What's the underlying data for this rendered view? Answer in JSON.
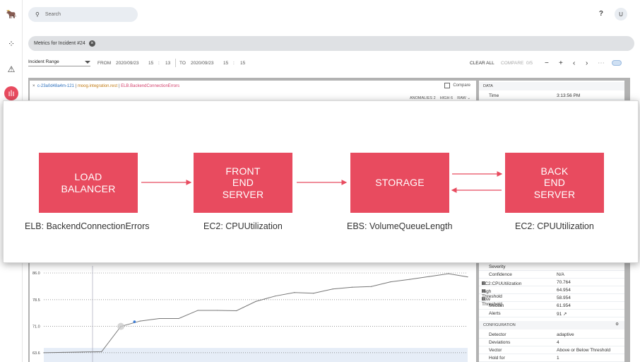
{
  "topbar": {
    "search_placeholder": "Search",
    "help": "?",
    "user_initial": "U"
  },
  "breadcrumb": {
    "label": "Metrics for Incident #24"
  },
  "controls": {
    "range_label": "Incident Range",
    "from_label": "FROM",
    "from_date": "2020/09/23",
    "from_hour": "15",
    "from_min": "13",
    "to_label": "TO",
    "to_date": "2020/09/23",
    "to_hour": "15",
    "to_min": "15",
    "clear_all": "CLEAR ALL",
    "compare": "COMPARE",
    "compare_count": "0/5"
  },
  "metric_card": {
    "close": "×",
    "host": "c-23a0d48a4m-121",
    "source": "moog.integration.rest",
    "metric": "ELB.BackendConnectionErrors",
    "compare_label": "Compare",
    "anomalies_label": "ANOMALIES",
    "anomalies": "2",
    "high_label": "HIGH",
    "high": "6",
    "raw_label": "RAW"
  },
  "data_panel": {
    "section_label": "DATA",
    "time_label": "Time",
    "time_value": "3:13:56 PM",
    "rows": [
      {
        "k": "Severity",
        "v": ""
      },
      {
        "k": "Confidence",
        "v": "N/A"
      },
      {
        "k": "EC2:CPUUtilization",
        "v": "70.764"
      },
      {
        "k": "High Threshold",
        "v": "64.954"
      },
      {
        "k": "Low Threshold",
        "v": "58.954"
      },
      {
        "k": "Median",
        "v": "61.954"
      },
      {
        "k": "Alerts",
        "v": "91 ↗"
      }
    ],
    "config_label": "CONFIGURATION",
    "config_rows": [
      {
        "k": "Detector",
        "v": "adaptive"
      },
      {
        "k": "Deviations",
        "v": "4"
      },
      {
        "k": "Vector",
        "v": "Above or Below Threshold"
      },
      {
        "k": "Hold for",
        "v": "1"
      }
    ]
  },
  "chart_data": {
    "type": "line",
    "y_ticks": [
      "86.0",
      "78.5",
      "71.0",
      "63.6"
    ],
    "ylim": [
      61,
      88
    ],
    "x": [
      0,
      1,
      2,
      3,
      4,
      5,
      6,
      7,
      8,
      9,
      10,
      11,
      12,
      13,
      14,
      15,
      16,
      17,
      18,
      19,
      20,
      21,
      22
    ],
    "values": [
      63.6,
      63.7,
      63.8,
      63.9,
      71.0,
      72.5,
      73.2,
      73.2,
      75.5,
      75.5,
      75.4,
      78.0,
      79.5,
      80.5,
      80.3,
      81.5,
      82.0,
      82.2,
      83.5,
      84.2,
      85.0,
      85.8,
      84.9
    ],
    "highlight_index": 4,
    "grid": true
  },
  "diagram": {
    "nodes": [
      {
        "label": "LOAD\nBALANCER",
        "caption": "ELB: BackendConnectionErrors"
      },
      {
        "label": "FRONT\nEND\nSERVER",
        "caption": "EC2: CPUUtilization"
      },
      {
        "label": "STORAGE",
        "caption": "EBS: VolumeQueueLength"
      },
      {
        "label": "BACK\nEND\nSERVER",
        "caption": "EC2: CPUUtilization"
      }
    ],
    "colors": {
      "node": "#e84b5f",
      "arrow": "#e84b5f"
    }
  }
}
